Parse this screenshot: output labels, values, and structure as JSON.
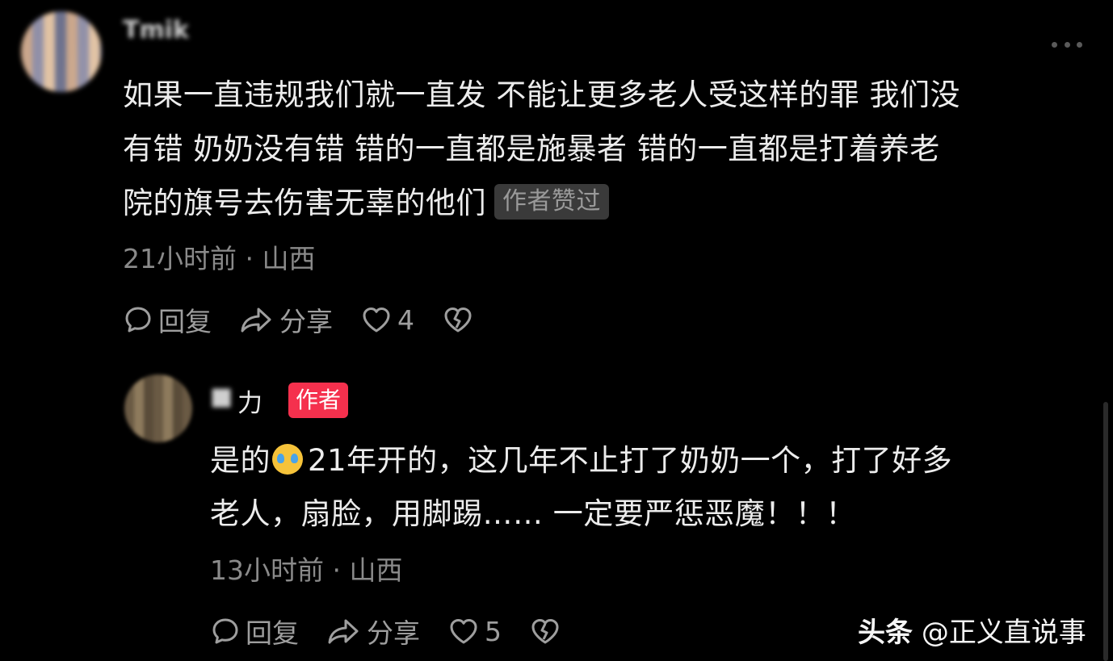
{
  "comment": {
    "username": "Tmik",
    "text_lines": [
      "如果一直违规我们就一直发 不能让更多老人受这样的罪 我们没",
      "有错 奶奶没有错 错的一直都是施暴者 错的一直都是打着养老",
      "院的旗号去伤害无辜的他们"
    ],
    "liked_badge": "作者赞过",
    "time": "21小时前 · 山西",
    "reply_label": "回复",
    "share_label": "分享",
    "like_count": "4"
  },
  "reply": {
    "username_visible": "力",
    "author_badge": "作者",
    "text_line1_prefix": "是的",
    "emoji": "crying-face",
    "text_line1_suffix": "21年开的，这几年不止打了奶奶一个，打了好多",
    "text_line2": "老人，扇脸，用脚踢…… 一定要严惩恶魔！！！",
    "time": "13小时前 · 山西",
    "reply_label": "回复",
    "share_label": "分享",
    "like_count": "5"
  },
  "watermark": {
    "brand": "头条",
    "handle": "@正义直说事"
  },
  "colors": {
    "background": "#000000",
    "author_badge": "#f5304d",
    "meta_text": "#8a8a8a"
  }
}
